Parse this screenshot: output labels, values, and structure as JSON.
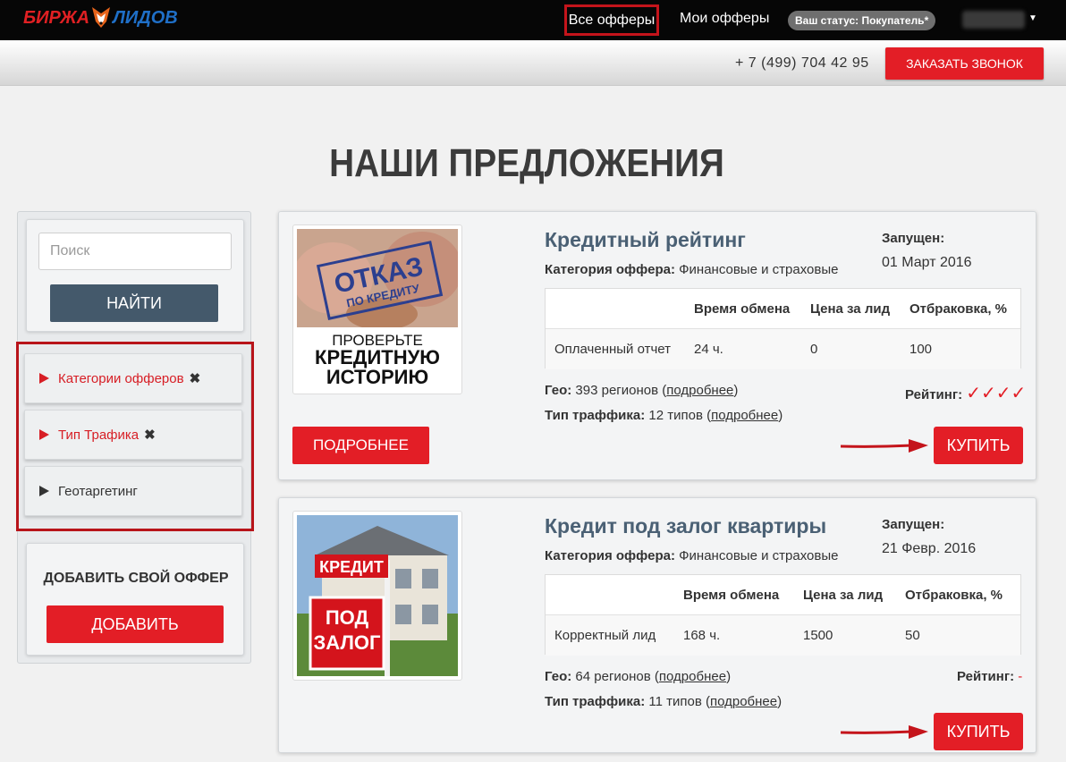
{
  "header": {
    "logo_part1": "БИРЖА",
    "logo_part2": "ЛИДОВ",
    "nav_all": "Все офферы",
    "nav_my": "Мои офферы",
    "status": "Ваш статус: Покупатель*"
  },
  "subheader": {
    "phone": "+ 7 (499) 704 42 95",
    "callback": "ЗАКАЗАТЬ ЗВОНОК"
  },
  "page": {
    "title": "НАШИ ПРЕДЛОЖЕНИЯ"
  },
  "sidebar": {
    "search_placeholder": "Поиск",
    "find_button": "НАЙТИ",
    "filters": [
      {
        "label": "Категории офферов",
        "active": true
      },
      {
        "label": "Тип Трафика",
        "active": true
      },
      {
        "label": "Геотаргетинг",
        "active": false
      }
    ],
    "add_title": "ДОБАВИТЬ СВОЙ ОФФЕР",
    "add_button": "ДОБАВИТЬ"
  },
  "offers": [
    {
      "title": "Кредитный рейтинг",
      "category_label": "Категория оффера:",
      "category": "Финансовые и страховые",
      "start_label": "Запущен:",
      "start_date": "01 Март 2016",
      "table_headers": [
        "Время обмена",
        "Цена за лид",
        "Отбраковка, %"
      ],
      "row": [
        "Оплаченный отчет",
        "24 ч.",
        "0",
        "100"
      ],
      "geo_label": "Гео:",
      "geo_value": "393 регионов (",
      "geo_link": "подробнее",
      "traffic_label": "Тип траффика:",
      "traffic_value": "12 типов (",
      "traffic_link": "подробнее",
      "rating_label": "Рейтинг:",
      "rating_value": "✓✓✓✓",
      "image_text_1": "ОТКАЗ",
      "image_text_2": "ПО КРЕДИТУ",
      "image_text_3": "ПРОВЕРЬТЕ",
      "image_text_4": "КРЕДИТНУЮ",
      "image_text_5": "ИСТОРИЮ",
      "more_button": "ПОДРОБНЕЕ",
      "buy_button": "КУПИТЬ"
    },
    {
      "title": "Кредит под залог квартиры",
      "category_label": "Категория оффера:",
      "category": "Финансовые и страховые",
      "start_label": "Запущен:",
      "start_date": "21 Февр. 2016",
      "table_headers": [
        "Время обмена",
        "Цена за лид",
        "Отбраковка, %"
      ],
      "row": [
        "Корректный лид",
        "168 ч.",
        "1500",
        "50"
      ],
      "geo_label": "Гео:",
      "geo_value": "64 регионов (",
      "geo_link": "подробнее",
      "traffic_label": "Тип траффика:",
      "traffic_value": "11 типов (",
      "traffic_link": "подробнее",
      "rating_label": "Рейтинг:",
      "rating_value": "-",
      "image_text_1": "КРЕДИТ",
      "image_text_2": "ПОД",
      "image_text_3": "ЗАЛОГ",
      "buy_button": "КУПИТЬ"
    }
  ]
}
